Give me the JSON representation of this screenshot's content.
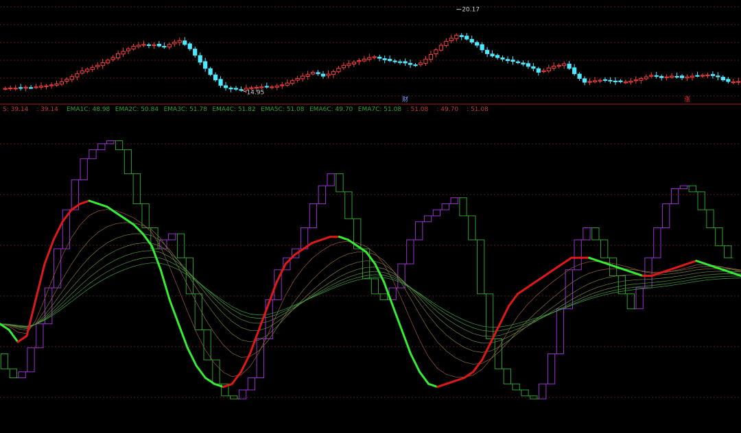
{
  "colors": {
    "background": "#000000",
    "up": "#ff4040",
    "down": "#4fe8ff",
    "grid": "#5a1e1e",
    "separator": "#9a1e1e",
    "cciUp": "#9b32d2",
    "cciDown": "#2fa22f",
    "trendUp": "#e01818",
    "trendDown": "#33ee33",
    "emaBase": "#8a5a4a",
    "markerCai": "#7aa0ff",
    "markerZhang": "#ff3030"
  },
  "price_panel": {
    "high_label": "20.17",
    "low_label": "14.95",
    "events": [
      {
        "text": "财",
        "kind": "cai",
        "bar": 78
      },
      {
        "text": "涨",
        "kind": "zhang",
        "bar": 133
      }
    ]
  },
  "indicator_header": [
    {
      "text": "S: 39.14",
      "color": "#c03c3c"
    },
    {
      "text": ": 39.14",
      "color": "#c03c3c"
    },
    {
      "text": "EMA1C: 48.98",
      "color": "#2fa22f"
    },
    {
      "text": "EMA2C: 50.84",
      "color": "#2fa22f"
    },
    {
      "text": "EMA3C: 51.78",
      "color": "#2fa22f"
    },
    {
      "text": "EMA4C: 51.82",
      "color": "#2fa22f"
    },
    {
      "text": "EMA5C: 51.08",
      "color": "#2fa22f"
    },
    {
      "text": "EMA6C: 49.70",
      "color": "#2fa22f"
    },
    {
      "text": "EMA7C: 51.08",
      "color": "#2fa22f"
    },
    {
      "text": ": 51.08",
      "color": "#c03c3c"
    },
    {
      "text": ": 49.70",
      "color": "#c03c3c"
    },
    {
      "text": ": 51.08",
      "color": "#c03c3c"
    }
  ],
  "chart_data": [
    {
      "type": "candlestick",
      "title": "",
      "ylim": [
        14.3,
        20.6
      ],
      "grid": true,
      "closes": [
        15.05,
        15.08,
        15.07,
        15.1,
        15.13,
        15.11,
        15.15,
        15.2,
        15.22,
        15.28,
        15.35,
        15.48,
        15.65,
        15.82,
        16.0,
        16.18,
        16.3,
        16.42,
        16.55,
        16.72,
        16.88,
        17.05,
        17.3,
        17.45,
        17.62,
        17.78,
        17.85,
        17.9,
        17.85,
        17.88,
        17.8,
        17.75,
        17.9,
        18.05,
        18.15,
        17.9,
        17.62,
        17.2,
        16.75,
        16.35,
        15.95,
        15.6,
        15.25,
        15.1,
        15.02,
        15.0,
        14.97,
        15.06,
        15.1,
        15.12,
        15.15,
        15.17,
        15.15,
        15.2,
        15.28,
        15.4,
        15.55,
        15.7,
        15.85,
        15.95,
        16.1,
        16.0,
        15.85,
        15.98,
        16.15,
        16.35,
        16.55,
        16.65,
        16.75,
        16.85,
        16.95,
        17.05,
        17.1,
        17.0,
        16.9,
        16.85,
        16.8,
        16.75,
        16.7,
        16.6,
        16.55,
        16.7,
        16.95,
        17.25,
        17.55,
        17.85,
        18.1,
        18.3,
        18.5,
        18.4,
        18.25,
        18.05,
        17.85,
        17.55,
        17.3,
        17.15,
        17.05,
        16.95,
        16.85,
        16.8,
        16.72,
        16.62,
        16.48,
        16.35,
        16.1,
        16.2,
        16.38,
        16.5,
        16.55,
        16.65,
        16.35,
        16.0,
        15.7,
        15.45,
        15.5,
        15.55,
        15.58,
        15.6,
        15.55,
        15.5,
        15.48,
        15.47,
        15.52,
        15.6,
        15.7,
        15.8,
        15.9,
        15.85,
        15.75,
        15.8,
        15.85,
        15.82,
        15.75,
        15.8,
        15.85,
        15.88,
        15.9,
        15.92,
        15.88,
        15.8,
        15.6,
        15.5,
        15.48,
        15.5
      ],
      "high": 20.17,
      "low": 14.95
    },
    {
      "type": "line",
      "title": "",
      "ylim": [
        -5,
        100
      ],
      "grid": true,
      "step_series": [
        20,
        15,
        12,
        14,
        22,
        30,
        42,
        55,
        68,
        78,
        85,
        88,
        90,
        91,
        88,
        80,
        70,
        62,
        55,
        58,
        60,
        52,
        40,
        28,
        18,
        10,
        6,
        5,
        8,
        12,
        25,
        38,
        48,
        52,
        55,
        62,
        70,
        76,
        80,
        74,
        65,
        55,
        45,
        40,
        38,
        42,
        50,
        58,
        64,
        66,
        68,
        70,
        72,
        66,
        58,
        40,
        25,
        15,
        10,
        8,
        6,
        5,
        10,
        20,
        35,
        48,
        58,
        62,
        58,
        52,
        46,
        40,
        35,
        42,
        52,
        62,
        70,
        75,
        76,
        74,
        68,
        62,
        56,
        52
      ],
      "trend_series": [
        30,
        28,
        24,
        26,
        38,
        50,
        58,
        64,
        68,
        70,
        71,
        70,
        69,
        67,
        65,
        63,
        60,
        56,
        48,
        38,
        30,
        22,
        16,
        12,
        10,
        9,
        10,
        14,
        20,
        28,
        36,
        44,
        50,
        53,
        55,
        57,
        58,
        59,
        59,
        58,
        56,
        54,
        50,
        44,
        36,
        28,
        20,
        14,
        10,
        9,
        10,
        11,
        12,
        14,
        18,
        24,
        30,
        36,
        40,
        42,
        44,
        46,
        48,
        50,
        52,
        52,
        52,
        51,
        50,
        49,
        48,
        47,
        46,
        46,
        47,
        48,
        49,
        50,
        51,
        50,
        49,
        48,
        47,
        46
      ],
      "ema_series_count": 7,
      "ema_labels": [
        "EMA1C",
        "EMA2C",
        "EMA3C",
        "EMA4C",
        "EMA5C",
        "EMA6C",
        "EMA7C"
      ],
      "ema_last_values": [
        48.98,
        50.84,
        51.78,
        51.82,
        51.08,
        49.7,
        51.08
      ]
    }
  ]
}
